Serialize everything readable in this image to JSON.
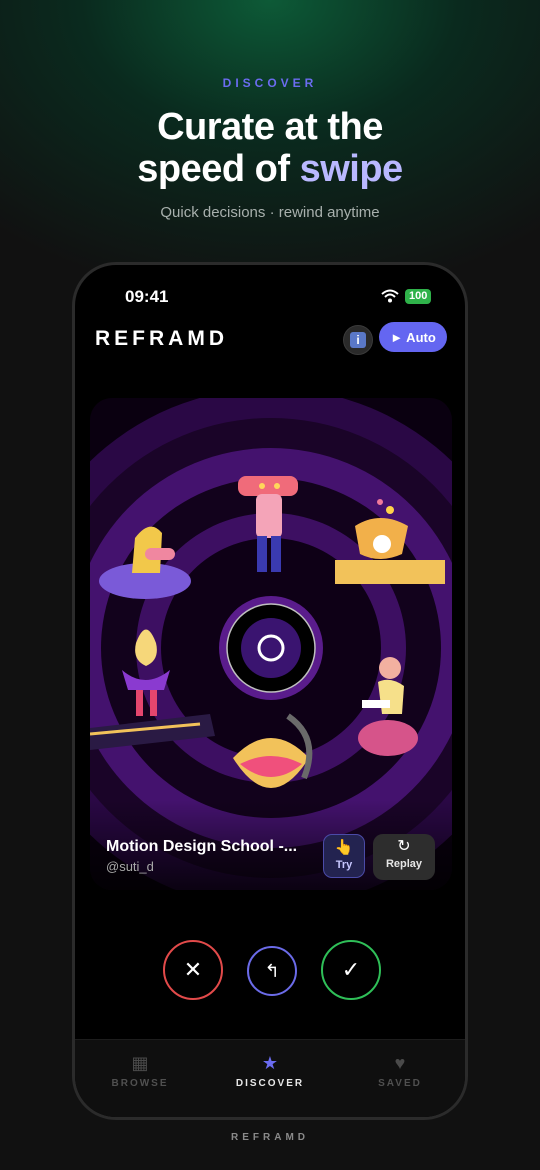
{
  "hero": {
    "eyebrow": "DISCOVER",
    "headline_part1": "Curate at the",
    "headline_part2": "speed of ",
    "headline_highlight": "swipe",
    "subline": "Quick decisions · rewind anytime"
  },
  "status_bar": {
    "time": "09:41",
    "battery": "100"
  },
  "app_header": {
    "brand": "REFRAMD",
    "info_icon": "i",
    "auto_label": "► Auto"
  },
  "card": {
    "title": "Motion Design School -...",
    "author": "@suti_d",
    "try_icon": "👆",
    "try_label": "Try",
    "replay_icon": "↻",
    "replay_label": "Replay"
  },
  "actions": {
    "reject_icon": "✕",
    "undo_icon": "↰",
    "accept_icon": "✓"
  },
  "tabs": [
    {
      "label": "BROWSE",
      "icon": "▦"
    },
    {
      "label": "DISCOVER",
      "icon": "★"
    },
    {
      "label": "SAVED",
      "icon": "♥"
    }
  ],
  "footer_brand": "REFRAMD",
  "colors": {
    "accent": "#6466f1",
    "reject": "#e24a4a",
    "accept": "#2fbf58",
    "highlight": "#b9b8ff"
  }
}
